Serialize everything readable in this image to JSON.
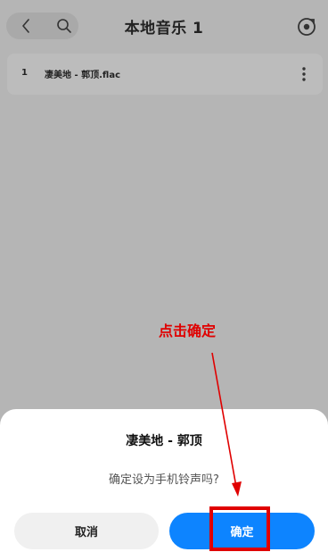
{
  "header": {
    "title": "本地音乐 1",
    "icons": {
      "back": "chevron-left-icon",
      "search": "search-icon",
      "locate": "locate-icon"
    }
  },
  "tracks": [
    {
      "index": "1",
      "name": "凄美地 - 郭顶.flac"
    }
  ],
  "dialog": {
    "title": "凄美地 - 郭顶",
    "message": "确定设为手机铃声吗?",
    "cancel_label": "取消",
    "confirm_label": "确定"
  },
  "annotation": {
    "label": "点击确定",
    "color": "#e00000"
  },
  "colors": {
    "overlay_bg": "#b5b5b5",
    "confirm_bg": "#0d84ff",
    "cancel_bg": "#f0f0f0"
  }
}
